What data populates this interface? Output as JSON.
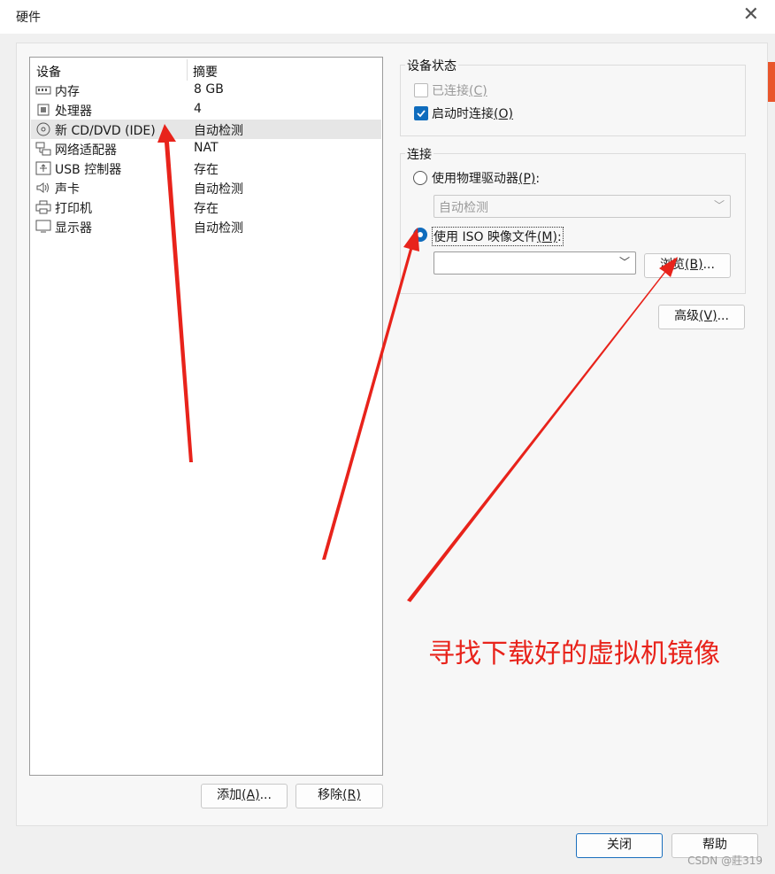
{
  "window": {
    "title": "硬件"
  },
  "devices": {
    "headers": {
      "device": "设备",
      "summary": "摘要"
    },
    "rows": [
      {
        "name": "内存",
        "summary": "8 GB",
        "icon": "memory-icon"
      },
      {
        "name": "处理器",
        "summary": "4",
        "icon": "processor-icon"
      },
      {
        "name": "新 CD/DVD (IDE)",
        "summary": "自动检测",
        "icon": "cd-dvd-icon",
        "selected": true
      },
      {
        "name": "网络适配器",
        "summary": "NAT",
        "icon": "network-adapter-icon"
      },
      {
        "name": "USB 控制器",
        "summary": "存在",
        "icon": "usb-icon"
      },
      {
        "name": "声卡",
        "summary": "自动检测",
        "icon": "speaker-icon"
      },
      {
        "name": "打印机",
        "summary": "存在",
        "icon": "printer-icon"
      },
      {
        "name": "显示器",
        "summary": "自动检测",
        "icon": "display-icon"
      }
    ]
  },
  "device_buttons": {
    "add": {
      "text": "添加",
      "key": "(A)",
      "tail": "..."
    },
    "remove": {
      "text": "移除",
      "key": "(R)",
      "tail": ""
    }
  },
  "device_status": {
    "title": "设备状态",
    "connected": {
      "text": "已连接",
      "key": "(C)",
      "checked": false,
      "enabled": false
    },
    "connect_at_power_on": {
      "text": "启动时连接",
      "key": "(O)",
      "checked": true,
      "enabled": true
    }
  },
  "connection": {
    "title": "连接",
    "physical_drive": {
      "text": "使用物理驱动器",
      "key": "(P)",
      "tail": ":",
      "selected": false
    },
    "physical_drive_select": "自动检测",
    "iso_image": {
      "text": "使用 ISO 映像文件",
      "key": "(M)",
      "tail": ":",
      "selected": true
    },
    "iso_path": "",
    "browse": {
      "text": "浏览",
      "key": "(B)",
      "tail": "..."
    }
  },
  "advanced_button": {
    "text": "高级",
    "key": "(V)",
    "tail": "..."
  },
  "footer": {
    "close": "关闭",
    "help": "帮助"
  },
  "annotation": {
    "text": "寻找下载好的虚拟机镜像",
    "color": "#e8231b"
  },
  "watermark": "CSDN @莊319"
}
